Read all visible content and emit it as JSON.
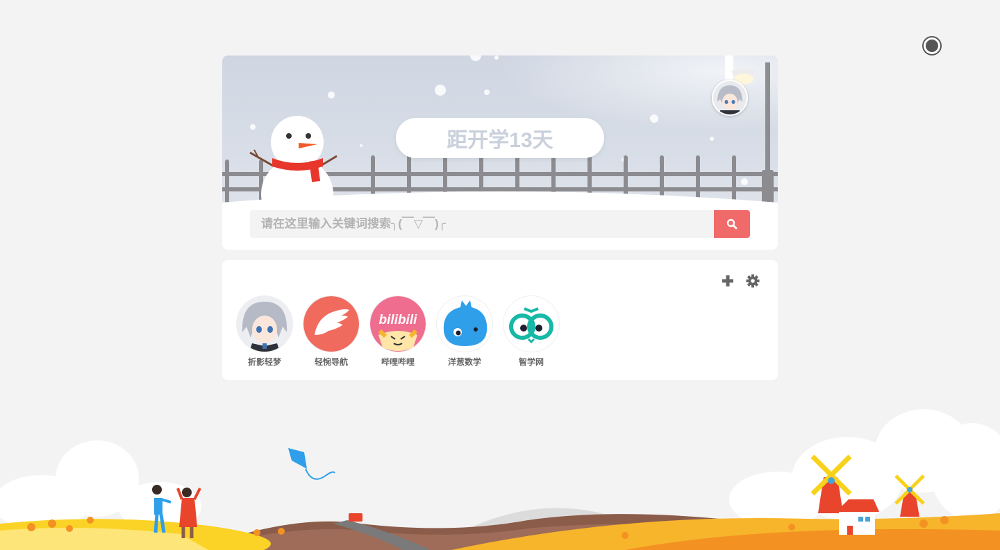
{
  "banner": {
    "countdown_text": "距开学13天"
  },
  "search": {
    "placeholder": "请在这里输入关键词搜索╮(￣▽￣)╭"
  },
  "toolbar": {
    "add_icon": "plus-icon",
    "settings_icon": "gear-icon"
  },
  "shortcuts": [
    {
      "label": "折影轻梦",
      "icon": "anime-avatar"
    },
    {
      "label": "轻惋导航",
      "icon": "red-wing-logo"
    },
    {
      "label": "哔哩哔哩",
      "icon": "bilibili-logo"
    },
    {
      "label": "洋葱数学",
      "icon": "blue-onion-mascot"
    },
    {
      "label": "智学网",
      "icon": "owl-logo"
    }
  ],
  "colors": {
    "accent": "#f06a6a",
    "background": "#f3f3f3",
    "card": "#ffffff"
  }
}
